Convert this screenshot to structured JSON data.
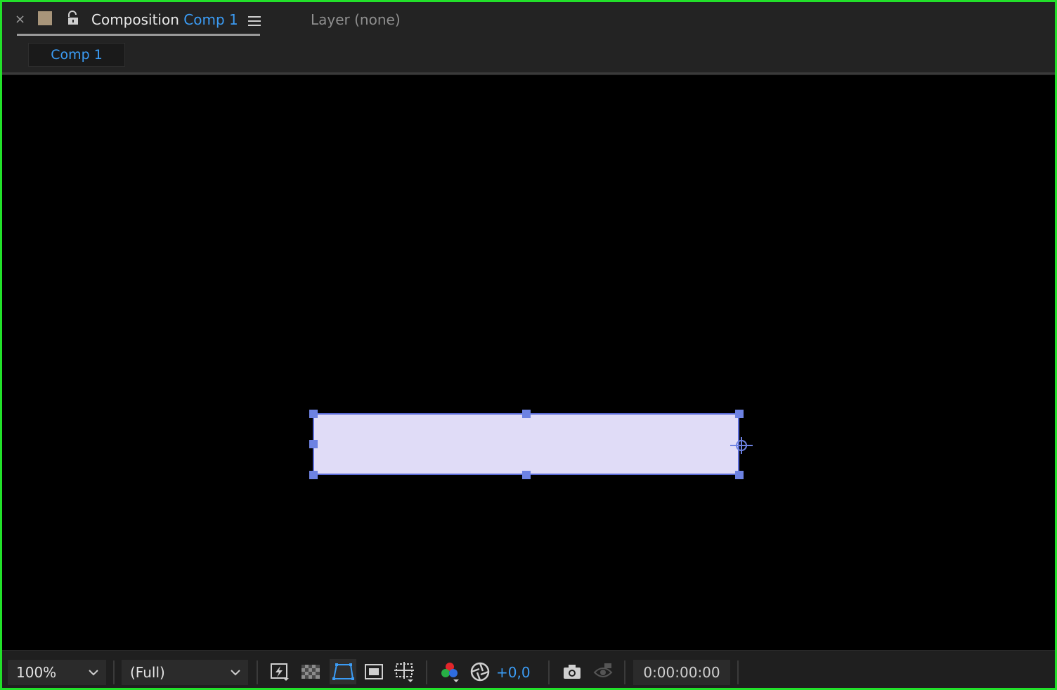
{
  "tabs": {
    "close_symbol": "×",
    "composition_label": "Composition",
    "composition_name": "Comp 1",
    "layer_label": "Layer (none)"
  },
  "breadcrumb": {
    "current": "Comp 1"
  },
  "toolbar": {
    "zoom": "100%",
    "resolution": "(Full)",
    "exposure": "+0,0",
    "timecode": "0:00:00:00"
  },
  "icons": [
    "close-icon",
    "label-color-swatch",
    "lock-icon",
    "panel-menu-icon",
    "chevron-down-icon",
    "fast-preview-icon",
    "transparency-grid-icon",
    "mask-visibility-icon",
    "region-of-interest-icon",
    "grid-guides-icon",
    "color-channels-icon",
    "reset-exposure-icon",
    "snapshot-camera-icon",
    "show-snapshot-icon"
  ],
  "colors": {
    "accent_blue": "#3b9cf5",
    "selection_handles": "#6d82e2",
    "shape_fill": "#e0dcf7",
    "panel_focus_border": "#22e02a"
  }
}
